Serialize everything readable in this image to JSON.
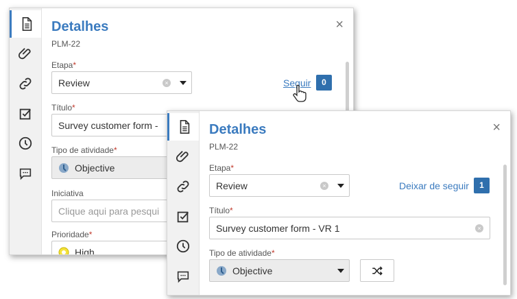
{
  "back": {
    "title": "Detalhes",
    "code": "PLM-22",
    "close": "×",
    "stage_label": "Etapa",
    "stage_value": "Review",
    "follow_label": "Seguir",
    "follow_count": "0",
    "title_label": "Título",
    "title_value": "Survey customer form -",
    "type_label": "Tipo de atividade",
    "type_value": "Objective",
    "initiative_label": "Iniciativa",
    "initiative_placeholder": "Clique aqui para pesqui",
    "priority_label": "Prioridade",
    "priority_value": "High"
  },
  "front": {
    "title": "Detalhes",
    "code": "PLM-22",
    "close": "×",
    "stage_label": "Etapa",
    "stage_value": "Review",
    "unfollow_label": "Deixar de seguir",
    "follow_count": "1",
    "title_label": "Título",
    "title_value": "Survey customer form - VR 1",
    "type_label": "Tipo de atividade",
    "type_value": "Objective"
  },
  "required_mark": "*",
  "clear_glyph": "×",
  "icons": [
    "document-icon",
    "paperclip-icon",
    "link-icon",
    "checkbox-icon",
    "clock-icon",
    "comment-icon",
    "shuffle-icon",
    "hand-cursor-icon"
  ],
  "colors": {
    "accent": "#3b7bbf",
    "badge": "#2f6fad",
    "required": "#c0392b"
  }
}
